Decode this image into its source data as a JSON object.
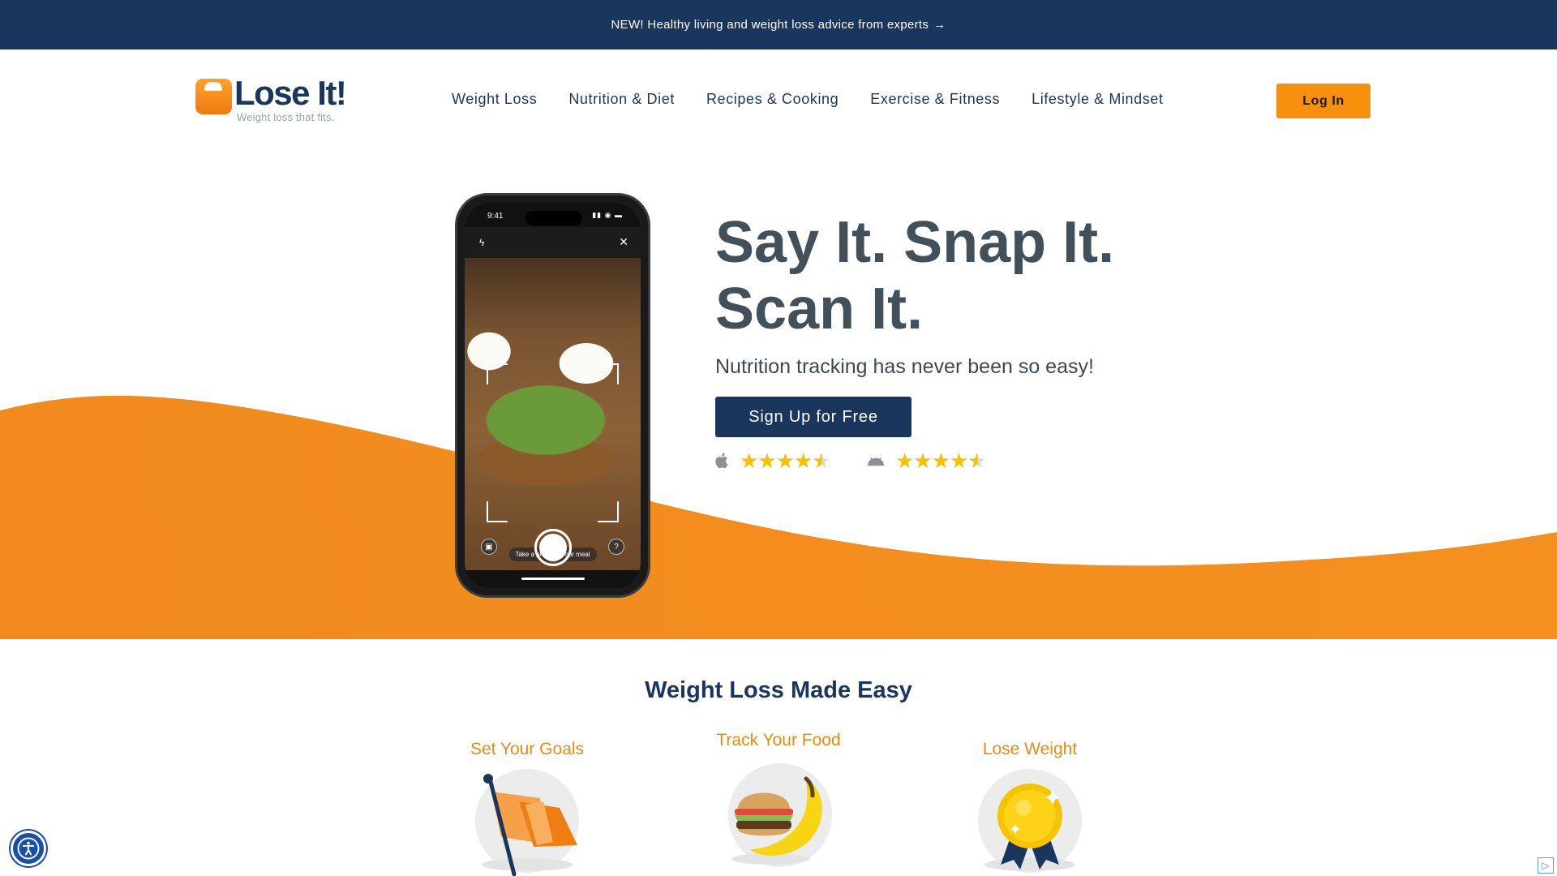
{
  "announcement": {
    "text": "NEW! Healthy living and weight loss advice from experts",
    "arrow": "→"
  },
  "brand": {
    "name": "Lose It!",
    "tagline": "Weight loss that fits.",
    "accent": "#f7900d",
    "navy": "#1b365d"
  },
  "nav": {
    "items": [
      {
        "label": "Weight Loss"
      },
      {
        "label": "Nutrition & Diet"
      },
      {
        "label": "Recipes & Cooking"
      },
      {
        "label": "Exercise & Fitness"
      },
      {
        "label": "Lifestyle & Mindset"
      }
    ],
    "login_label": "Log In"
  },
  "hero": {
    "headline_line1": "Say It. Snap It.",
    "headline_line2": "Scan It.",
    "subhead": "Nutrition tracking has never been so easy!",
    "cta_label": "Sign Up for Free",
    "ratings": [
      {
        "platform": "apple-icon",
        "stars": 4.5
      },
      {
        "platform": "android-icon",
        "stars": 4.5
      }
    ],
    "phone": {
      "time": "9:41",
      "hint": "Take a photo of your meal"
    }
  },
  "features": {
    "title": "Weight Loss Made Easy",
    "steps": [
      {
        "label": "Set Your Goals",
        "icon": "flag-icon"
      },
      {
        "label": "Track Your Food",
        "icon": "burger-banana-icon"
      },
      {
        "label": "Lose Weight",
        "icon": "medal-icon"
      }
    ]
  }
}
